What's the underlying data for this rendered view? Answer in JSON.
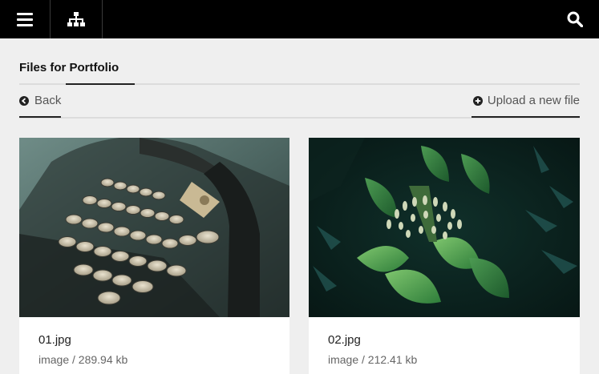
{
  "topbar": {
    "menu_icon": "hamburger-menu-icon",
    "sitemap_icon": "sitemap-icon",
    "search_icon": "search-icon"
  },
  "page": {
    "title": "Files for Portfolio"
  },
  "actions": {
    "back_label": "Back",
    "back_icon": "circle-arrow-left-icon",
    "upload_label": "Upload a new file",
    "upload_icon": "circle-plus-icon"
  },
  "files": [
    {
      "name": "01.jpg",
      "type": "image",
      "size": "289.94 kb",
      "meta": "image / 289.94 kb"
    },
    {
      "name": "02.jpg",
      "type": "image",
      "size": "212.41 kb",
      "meta": "image / 212.41 kb"
    }
  ]
}
